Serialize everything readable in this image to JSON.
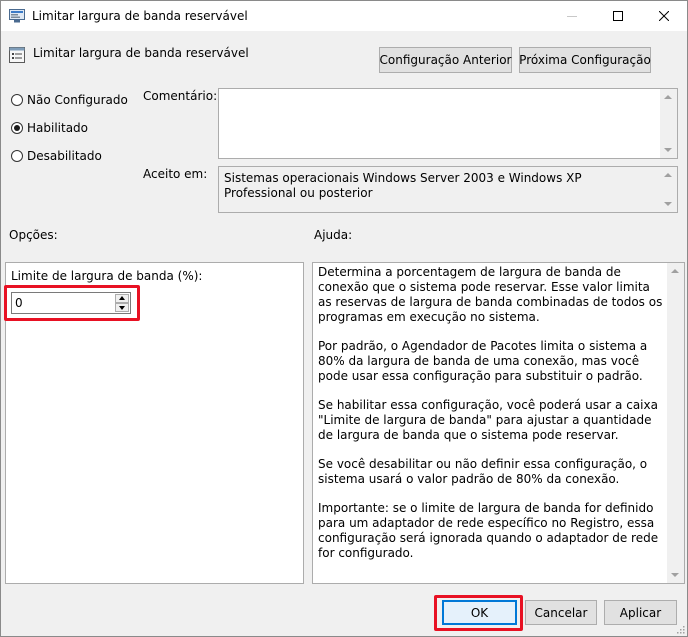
{
  "window": {
    "title": "Limitar largura de banda reservável",
    "minimize_icon": "minimize-icon",
    "maximize_icon": "maximize-icon",
    "close_icon": "close-icon"
  },
  "header": {
    "policy_title": "Limitar largura de banda reservável",
    "prev_button": "Configuração Anterior",
    "next_button": "Próxima Configuração"
  },
  "state": {
    "options": [
      {
        "label": "Não Configurado",
        "selected": false
      },
      {
        "label": "Habilitado",
        "selected": true
      },
      {
        "label": "Desabilitado",
        "selected": false
      }
    ]
  },
  "comment": {
    "label": "Comentário:",
    "value": ""
  },
  "supported": {
    "label": "Aceito em:",
    "value": "Sistemas operacionais Windows Server 2003 e Windows XP Professional ou posterior"
  },
  "options_panel": {
    "heading": "Opções:",
    "field_label": "Limite de largura de banda (%):",
    "field_value": "0"
  },
  "help_panel": {
    "heading": "Ajuda:",
    "paragraphs": [
      "Determina a porcentagem de largura de banda de conexão que o sistema pode reservar. Esse valor limita as reservas de largura de banda combinadas de todos os programas em execução no sistema.",
      "Por padrão, o Agendador de Pacotes limita o sistema a 80% da largura de banda de uma conexão, mas você pode usar essa configuração para substituir o padrão.",
      "Se habilitar essa configuração, você poderá usar a caixa \"Limite de largura de banda\" para ajustar a quantidade de largura de banda que o sistema pode reservar.",
      "Se você desabilitar ou não definir essa configuração, o sistema usará o valor padrão de 80% da conexão.",
      "Importante: se o limite de largura de banda for definido para um adaptador de rede específico no Registro, essa configuração será ignorada quando o adaptador de rede for configurado."
    ]
  },
  "footer": {
    "ok": "OK",
    "cancel": "Cancelar",
    "apply": "Aplicar"
  },
  "colors": {
    "highlight": "#e81123",
    "ok_border": "#0078d7"
  }
}
